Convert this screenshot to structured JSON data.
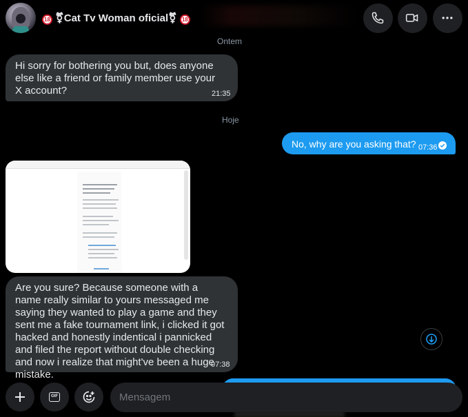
{
  "header": {
    "title": "🔞⚧Cat Tv Woman oficial⚧🔞",
    "name_text": "Cat Tv Woman oficial",
    "badge_text": "18",
    "symbol": "⚧"
  },
  "days": {
    "yesterday": "Ontem",
    "today": "Hoje"
  },
  "messages": {
    "m1": {
      "text": "Hi sorry for bothering you but, does anyone else like a friend or family member use your X account?",
      "time": "21:35"
    },
    "m2": {
      "text": "No, why are you asking that?",
      "time": "07:36"
    },
    "m3": {
      "text": "Are you sure? Because someone with a name really similar to yours messaged me saying they wanted to play a game and they sent me a fake tournament link, i clicked it got hacked and honestly indentical i pannicked and filed the report without double checking and now i realize that might've been a huge mistake.",
      "time": "07:38"
    }
  },
  "composer": {
    "placeholder": "Mensagem",
    "gif_label": "GIF"
  },
  "colors": {
    "background": "#000000",
    "bubble_in": "#2f3336",
    "bubble_out": "#1d9bf0",
    "button": "#1f2023",
    "muted": "#8b98a5"
  },
  "icons": [
    "phone-icon",
    "video-icon",
    "more-icon",
    "check-circle-icon",
    "arrow-down-icon",
    "plus-icon",
    "gif-icon",
    "emoji-icon"
  ]
}
